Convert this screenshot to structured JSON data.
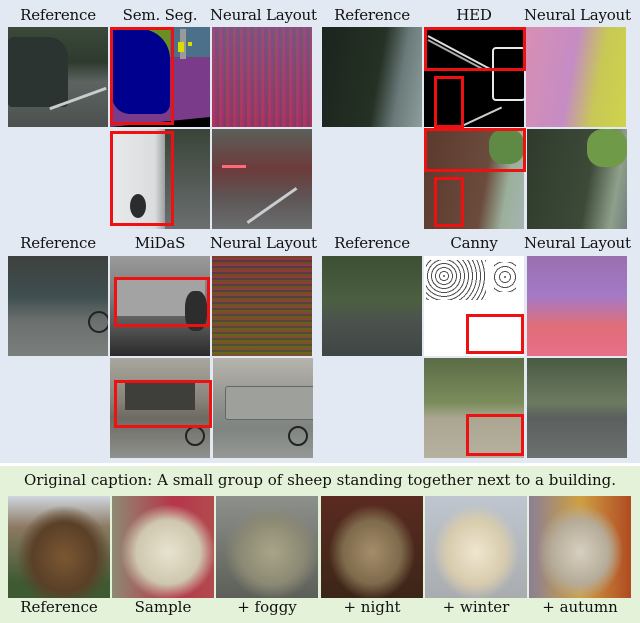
{
  "figure": {
    "panels": [
      {
        "id": "sem-seg",
        "headers": [
          "Reference",
          "Sem. Seg.",
          "Neural Layout"
        ],
        "rows": [
          [
            "reference-van",
            "semantic-segmentation-map",
            "neural-layout-map"
          ],
          [
            "",
            "edited-sample-white-van",
            "generated-sample-red-van"
          ]
        ]
      },
      {
        "id": "hed",
        "headers": [
          "Reference",
          "HED",
          "Neural Layout"
        ],
        "rows": [
          [
            "reference-wall-street",
            "hed-edge-map",
            "neural-layout-map"
          ],
          [
            "",
            "edited-sample-brick-wall",
            "generated-sample-wall"
          ]
        ]
      },
      {
        "id": "midas",
        "headers": [
          "Reference",
          "MiDaS",
          "Neural Layout"
        ],
        "rows": [
          [
            "reference-bus-cyclist",
            "midas-depth-map",
            "neural-layout-map"
          ],
          [
            "",
            "edited-sample-building-cyclist",
            "generated-sample-bus-cyclist"
          ]
        ]
      },
      {
        "id": "canny",
        "headers": [
          "Reference",
          "Canny",
          "Neural Layout"
        ],
        "rows": [
          [
            "reference-suburban-street",
            "canny-edge-map",
            "neural-layout-map"
          ],
          [
            "",
            "edited-sample-empty-road",
            "generated-sample-street"
          ]
        ]
      }
    ],
    "caption_section": {
      "caption": "Original caption: A small group of sheep standing together next to a building.",
      "labels": [
        "Reference",
        "Sample",
        "+ foggy",
        "+ night",
        "+ winter",
        "+ autumn"
      ]
    },
    "colors": {
      "top_background": "#e2e9f2",
      "bottom_background": "#e4f2d9",
      "highlight_box": "#ee1111"
    }
  }
}
